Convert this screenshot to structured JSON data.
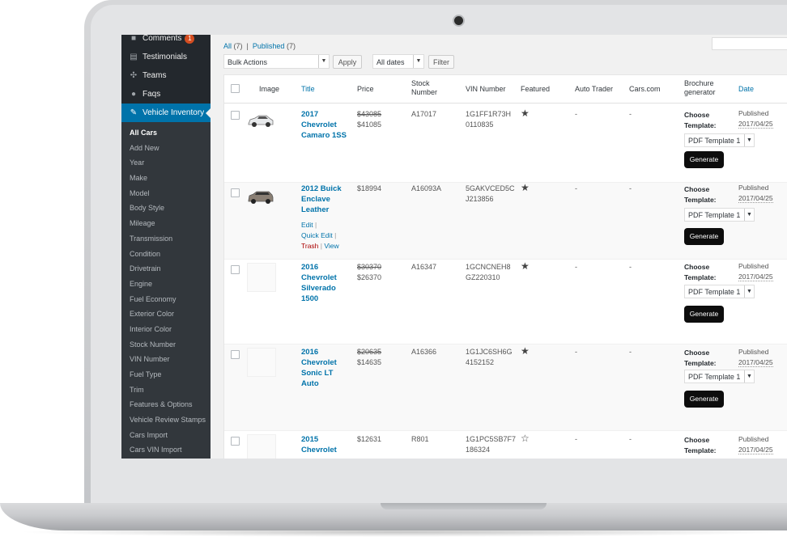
{
  "sidebar": {
    "top_items": [
      {
        "label": "Comments",
        "icon": "comment-icon",
        "badge": "1"
      },
      {
        "label": "Testimonials",
        "icon": "testimonial-icon"
      },
      {
        "label": "Teams",
        "icon": "teams-icon"
      },
      {
        "label": "Faqs",
        "icon": "info-icon"
      }
    ],
    "active_item": {
      "label": "Vehicle Inventory",
      "icon": "edit-icon"
    },
    "submenu": [
      "All Cars",
      "Add New",
      "Year",
      "Make",
      "Model",
      "Body Style",
      "Mileage",
      "Transmission",
      "Condition",
      "Drivetrain",
      "Engine",
      "Fuel Economy",
      "Exterior Color",
      "Interior Color",
      "Stock Number",
      "VIN Number",
      "Fuel Type",
      "Trim",
      "Features & Options",
      "Vehicle Review Stamps",
      "Cars Import",
      "Cars VIN Import"
    ]
  },
  "views": {
    "all_label": "All",
    "all_count": "(7)",
    "separator": "|",
    "published_label": "Published",
    "published_count": "(7)"
  },
  "tablenav": {
    "bulk_actions": "Bulk Actions",
    "apply": "Apply",
    "dates": "All dates",
    "filter": "Filter"
  },
  "columns": {
    "image": "Image",
    "title": "Title",
    "price": "Price",
    "stock_line1": "Stock",
    "stock_line2": "Number",
    "vin": "VIN Number",
    "featured": "Featured",
    "autotrader": "Auto Trader",
    "carscom": "Cars.com",
    "brochure_line1": "Brochure",
    "brochure_line2": "generator",
    "date": "Date"
  },
  "rows": [
    {
      "title_lines": [
        "2017",
        "Chevrolet",
        "Camaro 1SS"
      ],
      "old_price": "$43085",
      "price": "$41085",
      "stock": "A17017",
      "vin1": "1G1FF1R73H",
      "vin2": "0110835",
      "featured": "filled",
      "autotrader": "-",
      "carscom": "-",
      "choose1": "Choose",
      "choose2": "Template:",
      "template": "PDF Template 1",
      "generate": "Generate",
      "status": "Published",
      "date": "2017/04/25"
    },
    {
      "title_lines": [
        "2012 Buick",
        "Enclave",
        "Leather"
      ],
      "old_price": "",
      "price": "$18994",
      "stock": "A16093A",
      "vin1": "5GAKVCED5C",
      "vin2": "J213856",
      "featured": "filled",
      "autotrader": "-",
      "carscom": "-",
      "actions": {
        "edit": "Edit",
        "quick_edit": "Quick Edit",
        "trash": "Trash",
        "view": "View",
        "sep": "|"
      },
      "choose1": "Choose",
      "choose2": "Template:",
      "template": "PDF Template 1",
      "generate": "Generate",
      "status": "Published",
      "date": "2017/04/25"
    },
    {
      "title_lines": [
        "2016",
        "Chevrolet",
        "Silverado",
        "1500"
      ],
      "old_price": "$30370",
      "price": "$26370",
      "stock": "A16347",
      "vin1": "1GCNCNEH8",
      "vin2": "GZ220310",
      "featured": "filled",
      "autotrader": "-",
      "carscom": "-",
      "choose1": "Choose",
      "choose2": "Template:",
      "template": "PDF Template 1",
      "generate": "Generate",
      "status": "Published",
      "date": "2017/04/25"
    },
    {
      "title_lines": [
        "2016",
        "Chevrolet",
        "Sonic LT",
        "Auto"
      ],
      "old_price": "$20635",
      "price": "$14635",
      "stock": "A16366",
      "vin1": "1G1JC6SH6G",
      "vin2": "4152152",
      "featured": "filled",
      "autotrader": "-",
      "carscom": "-",
      "choose1": "Choose",
      "choose2": "Template:",
      "template": "PDF Template 1",
      "generate": "Generate",
      "status": "Published",
      "date": "2017/04/25"
    },
    {
      "title_lines": [
        "2015",
        "Chevrolet"
      ],
      "old_price": "",
      "price": "$12631",
      "stock": "R801",
      "vin1": "1G1PC5SB7F7",
      "vin2": "186324",
      "featured": "outline",
      "autotrader": "-",
      "carscom": "-",
      "choose1": "Choose",
      "choose2": "Template:",
      "status": "Published",
      "date": "2017/04/25"
    }
  ],
  "glyphs": {
    "star_filled": "★",
    "star_outline": "☆",
    "chevron": "▼"
  },
  "colors": {
    "wp_blue": "#0073aa",
    "sidebar_bg": "#23282d",
    "active_bg": "#0073aa"
  }
}
